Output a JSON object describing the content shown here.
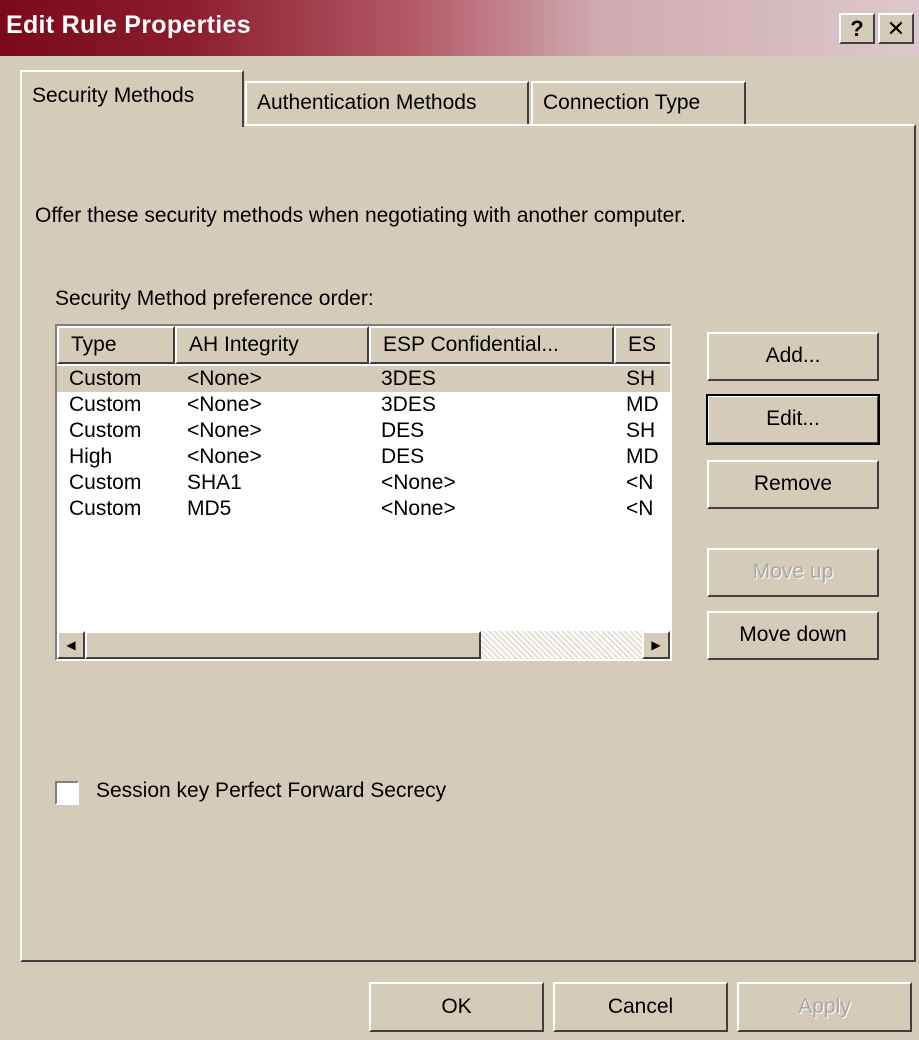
{
  "window": {
    "title": "Edit Rule Properties",
    "help_label": "?",
    "close_label": "✕"
  },
  "tabs": [
    {
      "label": "Security Methods",
      "active": true
    },
    {
      "label": "Authentication Methods",
      "active": false
    },
    {
      "label": "Connection Type",
      "active": false
    }
  ],
  "intro_text": "Offer these security methods when negotiating with another computer.",
  "list_label": "Security Method preference order:",
  "table": {
    "columns": [
      "Type",
      "AH Integrity",
      "ESP Confidential...",
      "ES"
    ],
    "rows": [
      [
        "Custom",
        "<None>",
        "3DES",
        "SH"
      ],
      [
        "Custom",
        "<None>",
        "3DES",
        "MD"
      ],
      [
        "Custom",
        "<None>",
        "DES",
        "SH"
      ],
      [
        "High",
        "<None>",
        "DES",
        "MD"
      ],
      [
        "Custom",
        "SHA1",
        "<None>",
        "<N"
      ],
      [
        "Custom",
        "MD5",
        "<None>",
        "<N"
      ]
    ],
    "selected_row": 0,
    "scroll_left_icon": "◀",
    "scroll_right_icon": "▶"
  },
  "side_buttons": {
    "add": "Add...",
    "edit": "Edit...",
    "remove": "Remove",
    "move_up": "Move up",
    "move_down": "Move down"
  },
  "checkbox": {
    "label": "Session key Perfect Forward Secrecy",
    "checked": false
  },
  "footer_buttons": {
    "ok": "OK",
    "cancel": "Cancel",
    "apply": "Apply"
  },
  "colors": {
    "dialog_face": "#d4ccb8",
    "title_bar_start": "#7a0a1a",
    "disabled_text": "#a8a8a8"
  }
}
